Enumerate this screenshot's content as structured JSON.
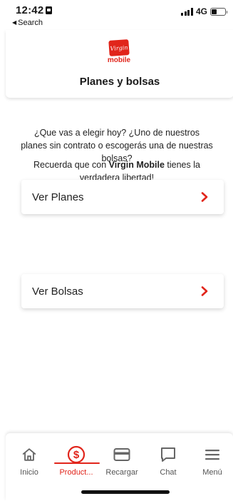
{
  "status_bar": {
    "time": "12:42",
    "back_label": "Search",
    "network": "4G"
  },
  "header": {
    "logo_text": "Virgin",
    "logo_word": "mobile",
    "title": "Planes y bolsas"
  },
  "intro": {
    "question": "¿Que vas a elegir hoy? ¿Uno de nuestros planes sin contrato o escogerás una de nuestras bolsas?",
    "reminder_prefix": "Recuerda que con ",
    "reminder_brand": "Virgin Mobile",
    "reminder_suffix": " tienes la verdadera libertad!"
  },
  "cards": [
    {
      "label": "Ver Planes"
    },
    {
      "label": "Ver Bolsas"
    }
  ],
  "bottom_nav": {
    "items": [
      {
        "label": "Inicio",
        "icon": "home-icon"
      },
      {
        "label": "Product...",
        "icon": "dollar-circle-icon"
      },
      {
        "label": "Recargar",
        "icon": "credit-card-icon"
      },
      {
        "label": "Chat",
        "icon": "chat-bubble-icon"
      },
      {
        "label": "Menú",
        "icon": "hamburger-menu-icon"
      }
    ],
    "active_index": 1
  },
  "colors": {
    "brand_red": "#e1251b",
    "text": "#1a1a1a",
    "muted": "#555555"
  }
}
